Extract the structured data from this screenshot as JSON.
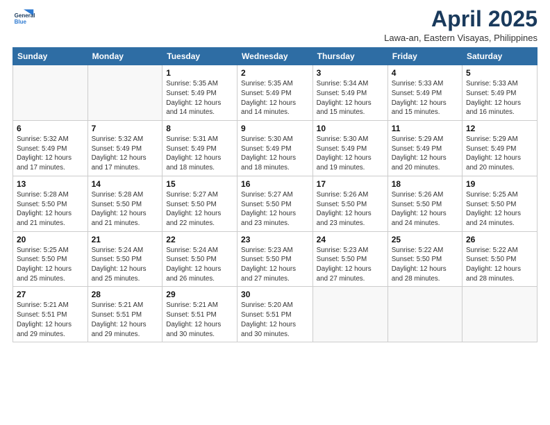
{
  "header": {
    "logo_line1": "General",
    "logo_line2": "Blue",
    "month_title": "April 2025",
    "location": "Lawa-an, Eastern Visayas, Philippines"
  },
  "days_of_week": [
    "Sunday",
    "Monday",
    "Tuesday",
    "Wednesday",
    "Thursday",
    "Friday",
    "Saturday"
  ],
  "weeks": [
    [
      {
        "num": "",
        "info": ""
      },
      {
        "num": "",
        "info": ""
      },
      {
        "num": "1",
        "info": "Sunrise: 5:35 AM\nSunset: 5:49 PM\nDaylight: 12 hours\nand 14 minutes."
      },
      {
        "num": "2",
        "info": "Sunrise: 5:35 AM\nSunset: 5:49 PM\nDaylight: 12 hours\nand 14 minutes."
      },
      {
        "num": "3",
        "info": "Sunrise: 5:34 AM\nSunset: 5:49 PM\nDaylight: 12 hours\nand 15 minutes."
      },
      {
        "num": "4",
        "info": "Sunrise: 5:33 AM\nSunset: 5:49 PM\nDaylight: 12 hours\nand 15 minutes."
      },
      {
        "num": "5",
        "info": "Sunrise: 5:33 AM\nSunset: 5:49 PM\nDaylight: 12 hours\nand 16 minutes."
      }
    ],
    [
      {
        "num": "6",
        "info": "Sunrise: 5:32 AM\nSunset: 5:49 PM\nDaylight: 12 hours\nand 17 minutes."
      },
      {
        "num": "7",
        "info": "Sunrise: 5:32 AM\nSunset: 5:49 PM\nDaylight: 12 hours\nand 17 minutes."
      },
      {
        "num": "8",
        "info": "Sunrise: 5:31 AM\nSunset: 5:49 PM\nDaylight: 12 hours\nand 18 minutes."
      },
      {
        "num": "9",
        "info": "Sunrise: 5:30 AM\nSunset: 5:49 PM\nDaylight: 12 hours\nand 18 minutes."
      },
      {
        "num": "10",
        "info": "Sunrise: 5:30 AM\nSunset: 5:49 PM\nDaylight: 12 hours\nand 19 minutes."
      },
      {
        "num": "11",
        "info": "Sunrise: 5:29 AM\nSunset: 5:49 PM\nDaylight: 12 hours\nand 20 minutes."
      },
      {
        "num": "12",
        "info": "Sunrise: 5:29 AM\nSunset: 5:49 PM\nDaylight: 12 hours\nand 20 minutes."
      }
    ],
    [
      {
        "num": "13",
        "info": "Sunrise: 5:28 AM\nSunset: 5:50 PM\nDaylight: 12 hours\nand 21 minutes."
      },
      {
        "num": "14",
        "info": "Sunrise: 5:28 AM\nSunset: 5:50 PM\nDaylight: 12 hours\nand 21 minutes."
      },
      {
        "num": "15",
        "info": "Sunrise: 5:27 AM\nSunset: 5:50 PM\nDaylight: 12 hours\nand 22 minutes."
      },
      {
        "num": "16",
        "info": "Sunrise: 5:27 AM\nSunset: 5:50 PM\nDaylight: 12 hours\nand 23 minutes."
      },
      {
        "num": "17",
        "info": "Sunrise: 5:26 AM\nSunset: 5:50 PM\nDaylight: 12 hours\nand 23 minutes."
      },
      {
        "num": "18",
        "info": "Sunrise: 5:26 AM\nSunset: 5:50 PM\nDaylight: 12 hours\nand 24 minutes."
      },
      {
        "num": "19",
        "info": "Sunrise: 5:25 AM\nSunset: 5:50 PM\nDaylight: 12 hours\nand 24 minutes."
      }
    ],
    [
      {
        "num": "20",
        "info": "Sunrise: 5:25 AM\nSunset: 5:50 PM\nDaylight: 12 hours\nand 25 minutes."
      },
      {
        "num": "21",
        "info": "Sunrise: 5:24 AM\nSunset: 5:50 PM\nDaylight: 12 hours\nand 25 minutes."
      },
      {
        "num": "22",
        "info": "Sunrise: 5:24 AM\nSunset: 5:50 PM\nDaylight: 12 hours\nand 26 minutes."
      },
      {
        "num": "23",
        "info": "Sunrise: 5:23 AM\nSunset: 5:50 PM\nDaylight: 12 hours\nand 27 minutes."
      },
      {
        "num": "24",
        "info": "Sunrise: 5:23 AM\nSunset: 5:50 PM\nDaylight: 12 hours\nand 27 minutes."
      },
      {
        "num": "25",
        "info": "Sunrise: 5:22 AM\nSunset: 5:50 PM\nDaylight: 12 hours\nand 28 minutes."
      },
      {
        "num": "26",
        "info": "Sunrise: 5:22 AM\nSunset: 5:50 PM\nDaylight: 12 hours\nand 28 minutes."
      }
    ],
    [
      {
        "num": "27",
        "info": "Sunrise: 5:21 AM\nSunset: 5:51 PM\nDaylight: 12 hours\nand 29 minutes."
      },
      {
        "num": "28",
        "info": "Sunrise: 5:21 AM\nSunset: 5:51 PM\nDaylight: 12 hours\nand 29 minutes."
      },
      {
        "num": "29",
        "info": "Sunrise: 5:21 AM\nSunset: 5:51 PM\nDaylight: 12 hours\nand 30 minutes."
      },
      {
        "num": "30",
        "info": "Sunrise: 5:20 AM\nSunset: 5:51 PM\nDaylight: 12 hours\nand 30 minutes."
      },
      {
        "num": "",
        "info": ""
      },
      {
        "num": "",
        "info": ""
      },
      {
        "num": "",
        "info": ""
      }
    ]
  ]
}
